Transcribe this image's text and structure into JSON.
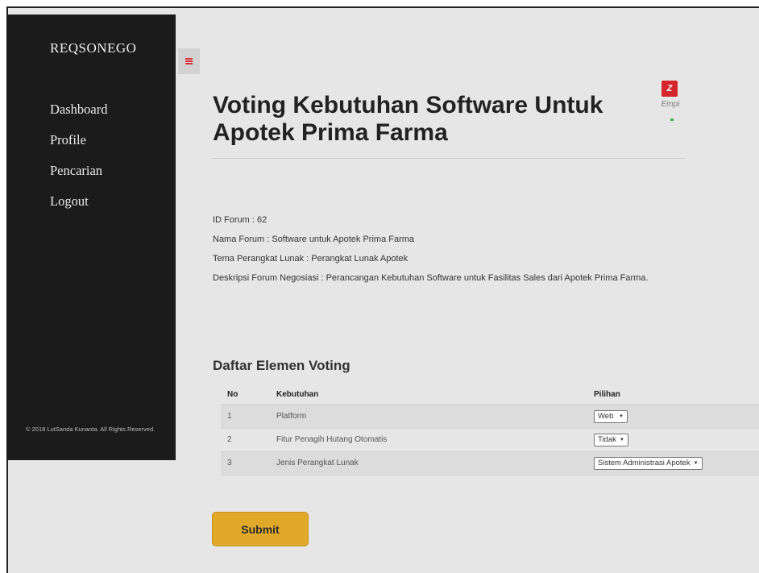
{
  "sidebar": {
    "brand": "REQSONEGO",
    "items": [
      {
        "label": "Dashboard"
      },
      {
        "label": "Profile"
      },
      {
        "label": "Pencarian"
      },
      {
        "label": "Logout"
      }
    ],
    "copyright": "© 2018 LutSanda Kunanta. All Rights Reserved."
  },
  "user": {
    "name": "Empi",
    "avatar_glyph": "Z"
  },
  "page": {
    "title": "Voting Kebutuhan Software Untuk Apotek Prima Farma"
  },
  "info": {
    "id_forum": "ID Forum : 62",
    "nama_forum": "Nama Forum : Software untuk Apotek Prima Farma",
    "tema": "Tema Perangkat Lunak : Perangkat Lunak Apotek",
    "deskripsi": "Deskripsi Forum Negosiasi : Perancangan Kebutuhan Software untuk Fasilitas Sales dari Apotek Prima Farma."
  },
  "voting": {
    "section_title": "Daftar Elemen Voting",
    "headers": {
      "no": "No",
      "kebutuhan": "Kebutuhan",
      "pilihan": "Pilihan"
    },
    "rows": [
      {
        "no": "1",
        "kebutuhan": "Platform",
        "pilihan": "Web"
      },
      {
        "no": "2",
        "kebutuhan": "Fitur Penagih Hutang Otomatis",
        "pilihan": "Tidak"
      },
      {
        "no": "3",
        "kebutuhan": "Jenis Perangkat Lunak",
        "pilihan": "Sistem Administrasi Apotek"
      }
    ]
  },
  "submit_label": "Submit",
  "colors": {
    "sidebar_bg": "#1b1b1b",
    "submit_bg": "#e0a92a",
    "toggle_icon": "#d9303a",
    "avatar_bg": "#d5252d"
  },
  "icons": {
    "sidebar_toggle": "hamburger-icon",
    "select_arrow": "caret-down-icon"
  }
}
